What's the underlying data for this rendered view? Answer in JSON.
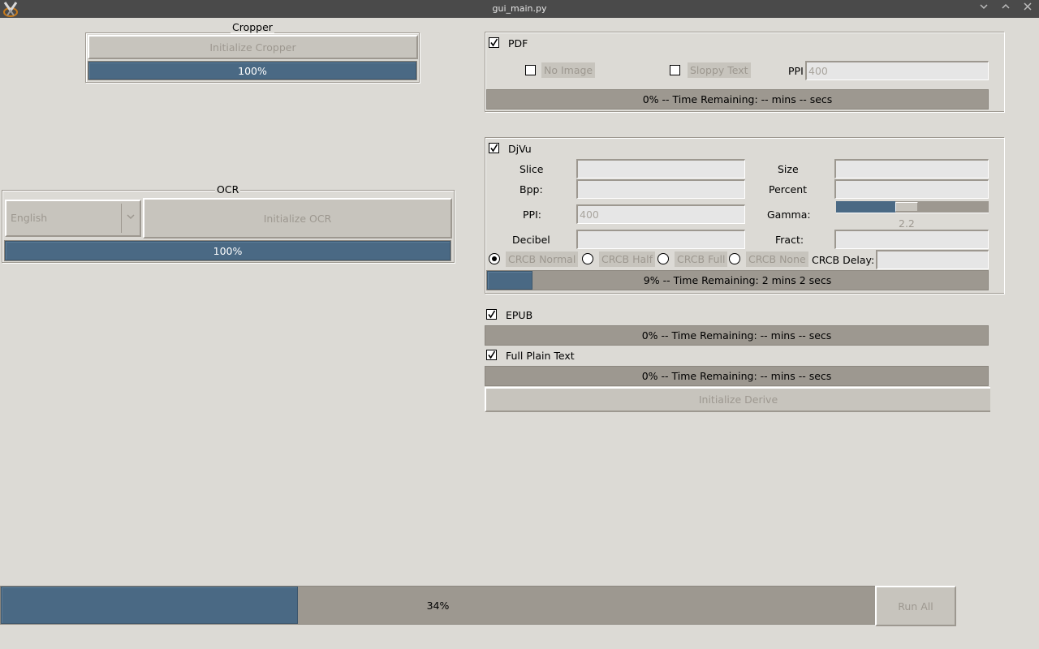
{
  "window": {
    "title": "gui_main.py",
    "controls": [
      "minimize-icon",
      "maximize-icon",
      "close-icon"
    ]
  },
  "cropper": {
    "group_label": "Cropper",
    "init_button": "Initialize Cropper",
    "progress": {
      "percent": 100,
      "text": "100%"
    }
  },
  "ocr": {
    "group_label": "OCR",
    "language_selected": "English",
    "init_button": "Initialize OCR",
    "progress": {
      "percent": 100,
      "text": "100%"
    }
  },
  "pdf": {
    "label": "PDF",
    "checked": true,
    "no_image": {
      "label": "No Image",
      "checked": false
    },
    "sloppy_text": {
      "label": "Sloppy Text",
      "checked": false
    },
    "ppi_label": "PPI",
    "ppi_value": "400",
    "progress": {
      "percent": 0,
      "text": "0% -- Time Remaining: -- mins -- secs"
    }
  },
  "djvu": {
    "label": "DjVu",
    "checked": true,
    "slice_label": "Slice",
    "slice_value": "",
    "size_label": "Size",
    "size_value": "",
    "bpp_label": "Bpp:",
    "bpp_value": "",
    "percent_label": "Percent",
    "percent_value": "",
    "ppi_label": "PPI:",
    "ppi_value": "400",
    "gamma_label": "Gamma:",
    "gamma_value": "2.2",
    "gamma_fraction": 0.39,
    "decibel_label": "Decibel",
    "decibel_value": "",
    "fract_label": "Fract:",
    "fract_value": "",
    "crcb_options": [
      {
        "label": "CRCB Normal",
        "selected": true
      },
      {
        "label": "CRCB Half",
        "selected": false
      },
      {
        "label": "CRCB Full",
        "selected": false
      },
      {
        "label": "CRCB None",
        "selected": false
      }
    ],
    "crcb_delay_label": "CRCB Delay:",
    "crcb_delay_value": "",
    "progress": {
      "percent": 9,
      "text": "9% -- Time Remaining: 2 mins 2 secs"
    }
  },
  "epub": {
    "label": "EPUB",
    "checked": true,
    "progress": {
      "percent": 0,
      "text": "0% -- Time Remaining: -- mins -- secs"
    }
  },
  "full_plain_text": {
    "label": "Full Plain Text",
    "checked": true,
    "progress": {
      "percent": 0,
      "text": "0% -- Time Remaining: -- mins -- secs"
    }
  },
  "derive": {
    "init_button": "Initialize Derive"
  },
  "overall": {
    "progress": {
      "percent": 34,
      "text": "34%"
    },
    "run_all_button": "Run All"
  },
  "colors": {
    "background": "#dcdad5",
    "progress_fill": "#4a6984",
    "progress_trough": "#9d9890",
    "button_bg": "#c7c4bd",
    "titlebar": "#4a4a4a"
  }
}
